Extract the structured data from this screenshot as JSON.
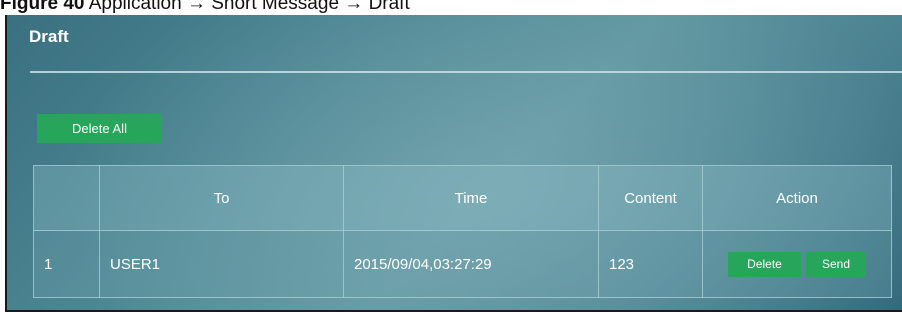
{
  "caption": {
    "figure_label": "Figure 40",
    "text": "Application → Short Message → Draft"
  },
  "panel": {
    "title": "Draft",
    "delete_all_label": "Delete All"
  },
  "table": {
    "headers": [
      "",
      "To",
      "Time",
      "Content",
      "Action"
    ],
    "rows": [
      {
        "index": "1",
        "to": "USER1",
        "time": "2015/09/04,03:27:29",
        "content": "123",
        "actions": {
          "delete_label": "Delete",
          "send_label": "Send"
        }
      }
    ]
  },
  "colors": {
    "button_green": "#27a55a",
    "panel_teal": "#4c8592",
    "text_white": "#ffffff"
  }
}
